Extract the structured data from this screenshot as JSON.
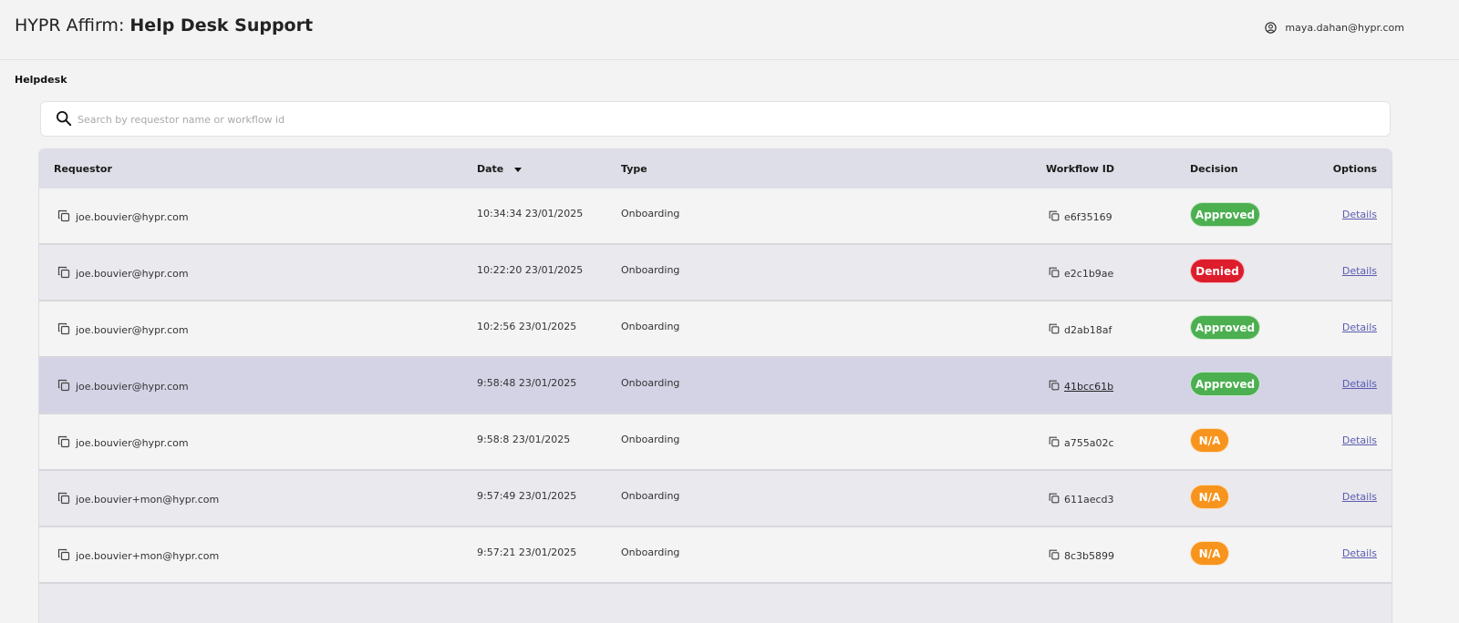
{
  "header": {
    "app_prefix": "HYPR Affirm:",
    "page_title": "Help Desk Support",
    "user_email": "maya.dahan@hypr.com"
  },
  "section_label": "Helpdesk",
  "search": {
    "placeholder": "Search by requestor name or workflow id",
    "value": ""
  },
  "table": {
    "columns": {
      "requestor": "Requestor",
      "date": "Date",
      "type": "Type",
      "workflow_id": "Workflow ID",
      "decision": "Decision",
      "options": "Options"
    },
    "rows": [
      {
        "requestor": "joe.bouvier@hypr.com",
        "date": "10:34:34 23/01/2025",
        "type": "Onboarding",
        "workflow_id": "e6f35169",
        "decision": "Approved",
        "option": "Details"
      },
      {
        "requestor": "joe.bouvier@hypr.com",
        "date": "10:22:20 23/01/2025",
        "type": "Onboarding",
        "workflow_id": "e2c1b9ae",
        "decision": "Denied",
        "option": "Details"
      },
      {
        "requestor": "joe.bouvier@hypr.com",
        "date": "10:2:56 23/01/2025",
        "type": "Onboarding",
        "workflow_id": "d2ab18af",
        "decision": "Approved",
        "option": "Details"
      },
      {
        "requestor": "joe.bouvier@hypr.com",
        "date": "9:58:48 23/01/2025",
        "type": "Onboarding",
        "workflow_id": "41bcc61b",
        "decision": "Approved",
        "option": "Details"
      },
      {
        "requestor": "joe.bouvier@hypr.com",
        "date": "9:58:8 23/01/2025",
        "type": "Onboarding",
        "workflow_id": "a755a02c",
        "decision": "N/A",
        "option": "Details"
      },
      {
        "requestor": "joe.bouvier+mon@hypr.com",
        "date": "9:57:49 23/01/2025",
        "type": "Onboarding",
        "workflow_id": "611aecd3",
        "decision": "N/A",
        "option": "Details"
      },
      {
        "requestor": "joe.bouvier+mon@hypr.com",
        "date": "9:57:21 23/01/2025",
        "type": "Onboarding",
        "workflow_id": "8c3b5899",
        "decision": "N/A",
        "option": "Details"
      }
    ]
  },
  "icons": {
    "user": "user-circle-icon",
    "search": "search-icon",
    "copy": "copy-icon",
    "sort": "caret-down-icon"
  },
  "colors": {
    "approved": "#4caf50",
    "denied": "#dd1c2c",
    "na": "#f7941d",
    "header_bg": "#dedee8",
    "row_hover": "#d4d3e6",
    "link": "#5b5bb0"
  }
}
